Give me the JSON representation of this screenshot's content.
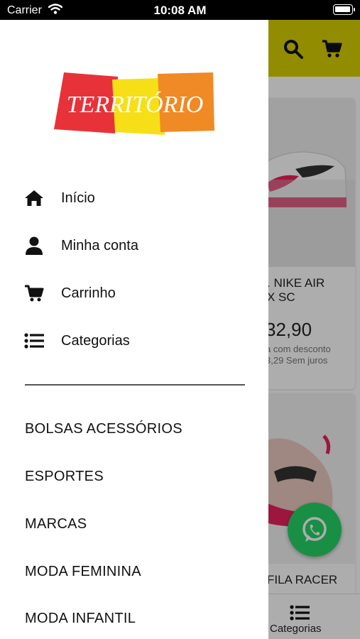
{
  "status_bar": {
    "carrier": "Carrier",
    "time": "10:08 AM"
  },
  "brand": {
    "logo_text": "TERRITÓRIO",
    "colors": {
      "red": "#e8323a",
      "yellow": "#f6df16",
      "orange": "#f08a24"
    }
  },
  "drawer": {
    "menu": [
      {
        "label": "Início",
        "icon": "home-icon"
      },
      {
        "label": "Minha conta",
        "icon": "user-icon"
      },
      {
        "label": "Carrinho",
        "icon": "cart-icon"
      },
      {
        "label": "Categorias",
        "icon": "list-icon"
      }
    ],
    "categories": [
      "BOLSAS ACESSÓRIOS",
      "ESPORTES",
      "MARCAS",
      "MODA FEMININA",
      "MODA INFANTIL"
    ]
  },
  "background": {
    "header_color": "#d7d000",
    "products": [
      {
        "title_line1": ". NIKE AIR",
        "title_line2": "X SC",
        "price": "32,90",
        "sub1": "a com desconto",
        "sub2": "3,29 Sem juros"
      },
      {
        "title_line1": "FILA RACER",
        "title_line2": ""
      }
    ],
    "bottom_nav": {
      "label": "Categorias"
    }
  }
}
